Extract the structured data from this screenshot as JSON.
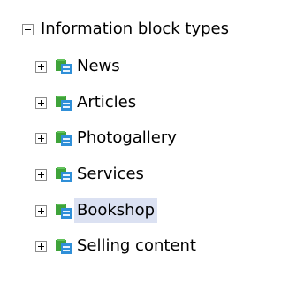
{
  "tree": {
    "root": {
      "label": "Information block types",
      "expanded": true,
      "toggle_icon": "collapse-minus-icon"
    },
    "items": [
      {
        "label": "News",
        "icon": "infoblock-folder-icon",
        "toggle_icon": "expand-plus-icon"
      },
      {
        "label": "Articles",
        "icon": "infoblock-folder-icon",
        "toggle_icon": "expand-plus-icon"
      },
      {
        "label": "Photogallery",
        "icon": "infoblock-folder-icon",
        "toggle_icon": "expand-plus-icon"
      },
      {
        "label": "Services",
        "icon": "infoblock-folder-icon",
        "toggle_icon": "expand-plus-icon"
      },
      {
        "label": "Bookshop",
        "icon": "infoblock-folder-icon",
        "toggle_icon": "expand-plus-icon",
        "selected": true
      },
      {
        "label": "Selling content",
        "icon": "infoblock-folder-icon",
        "toggle_icon": "expand-plus-icon"
      }
    ],
    "colors": {
      "selection_bg": "#dbe1f2",
      "toggle_border": "#8c8c8c",
      "icon_green": "#3fa33a",
      "icon_blue": "#2f8fd8"
    }
  }
}
